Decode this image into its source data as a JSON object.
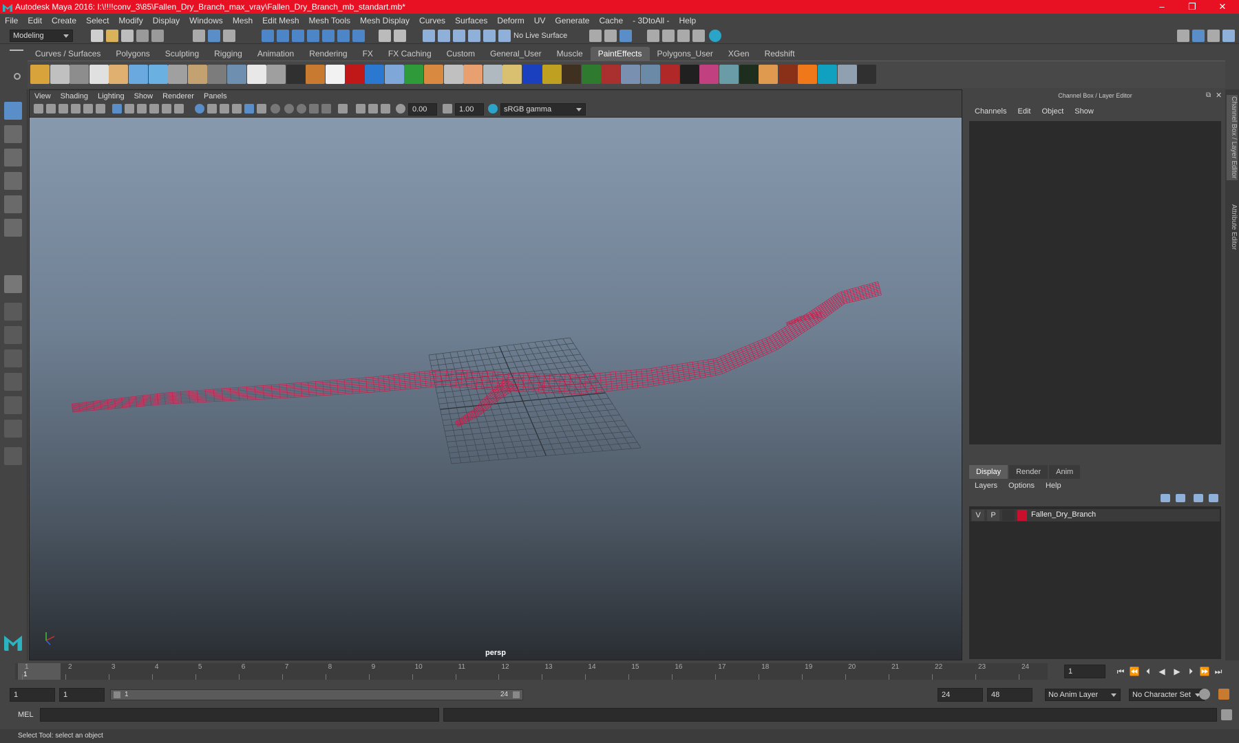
{
  "window": {
    "title": "Autodesk Maya 2016: I:\\!!!!conv_3\\85\\Fallen_Dry_Branch_max_vray\\Fallen_Dry_Branch_mb_standart.mb*",
    "minimize": "–",
    "maximize": "❐",
    "close": "✕"
  },
  "menubar": [
    "File",
    "Edit",
    "Create",
    "Select",
    "Modify",
    "Display",
    "Windows",
    "Mesh",
    "Edit Mesh",
    "Mesh Tools",
    "Mesh Display",
    "Curves",
    "Surfaces",
    "Deform",
    "UV",
    "Generate",
    "Cache",
    "- 3DtoAll -",
    "Help"
  ],
  "statusline": {
    "mode": "Modeling",
    "live_surface": "No Live Surface"
  },
  "shelf": {
    "tabs": [
      "Curves / Surfaces",
      "Polygons",
      "Sculpting",
      "Rigging",
      "Animation",
      "Rendering",
      "FX",
      "FX Caching",
      "Custom",
      "General_User",
      "Muscle",
      "PaintEffects",
      "Polygons_User",
      "XGen",
      "Redshift"
    ],
    "active_tab": "PaintEffects",
    "icon_colors": [
      "#d9a33b",
      "#c0c0c0",
      "#8d8d8d",
      "#e0e0e0",
      "#e0b070",
      "#6aa9e0",
      "#6ab0e0",
      "#a0a0a0",
      "#c3a170",
      "#7c7c7c",
      "#6f8fb0",
      "#e8e8e8",
      "#9f9f9f",
      "#303030",
      "#c87a30",
      "#f2f2f2",
      "#c01818",
      "#2a78d0",
      "#7fa8d8",
      "#2f9a3a",
      "#d98a40",
      "#c0c0c0",
      "#e8a070",
      "#b0b8c0",
      "#d8c070",
      "#1a40c0",
      "#c0a020",
      "#403020",
      "#2e7a2e",
      "#aa3030",
      "#7a90b0",
      "#6a8aa8",
      "#b02828",
      "#202020",
      "#c04080",
      "#6a9ca8",
      "#1e2e1e",
      "#e09a50",
      "#8a3018",
      "#f07818",
      "#10a0c0",
      "#90a0b0",
      "#303030"
    ]
  },
  "viewport": {
    "menu": [
      "View",
      "Shading",
      "Lighting",
      "Show",
      "Renderer",
      "Panels"
    ],
    "exposure": "0.00",
    "gamma": "1.00",
    "color_space": "sRGB gamma",
    "camera_label": "persp",
    "wire_color": "#cc1c4a"
  },
  "channel_box": {
    "title": "Channel Box / Layer Editor",
    "menu": [
      "Channels",
      "Edit",
      "Object",
      "Show"
    ]
  },
  "layer_editor": {
    "tabs": [
      "Display",
      "Render",
      "Anim"
    ],
    "active_tab": "Display",
    "menu": [
      "Layers",
      "Options",
      "Help"
    ],
    "layers": [
      {
        "visible": "V",
        "playback": "P",
        "color": "#c8102e",
        "name": "Fallen_Dry_Branch"
      }
    ]
  },
  "side_tabs": [
    "Channel Box / Layer Editor",
    "Attribute Editor"
  ],
  "timeline": {
    "ticks": [
      "1",
      "2",
      "3",
      "4",
      "5",
      "6",
      "7",
      "8",
      "9",
      "10",
      "11",
      "12",
      "13",
      "14",
      "15",
      "16",
      "17",
      "18",
      "19",
      "20",
      "21",
      "22",
      "23",
      "24"
    ],
    "current_frame_marker": "1",
    "current_frame_field": "1"
  },
  "range": {
    "start": "1",
    "playback_start": "1",
    "slider_start": "1",
    "slider_end": "24",
    "playback_end": "24",
    "end": "48",
    "anim_layer": "No Anim Layer",
    "character_set": "No Character Set"
  },
  "command_line": {
    "label": "MEL"
  },
  "help_line": "Select Tool: select an object"
}
